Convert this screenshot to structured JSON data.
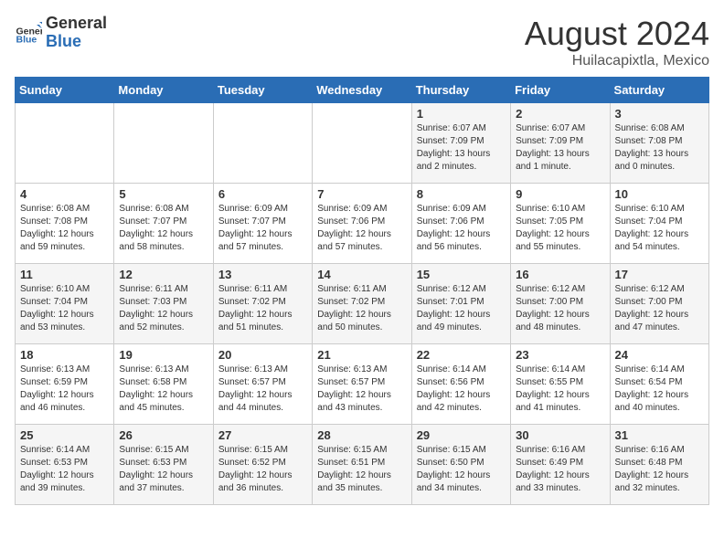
{
  "logo": {
    "general": "General",
    "blue": "Blue"
  },
  "title": {
    "month_year": "August 2024",
    "location": "Huilacapixtla, Mexico"
  },
  "days_of_week": [
    "Sunday",
    "Monday",
    "Tuesday",
    "Wednesday",
    "Thursday",
    "Friday",
    "Saturday"
  ],
  "weeks": [
    [
      {
        "day": "",
        "content": ""
      },
      {
        "day": "",
        "content": ""
      },
      {
        "day": "",
        "content": ""
      },
      {
        "day": "",
        "content": ""
      },
      {
        "day": "1",
        "content": "Sunrise: 6:07 AM\nSunset: 7:09 PM\nDaylight: 13 hours\nand 2 minutes."
      },
      {
        "day": "2",
        "content": "Sunrise: 6:07 AM\nSunset: 7:09 PM\nDaylight: 13 hours\nand 1 minute."
      },
      {
        "day": "3",
        "content": "Sunrise: 6:08 AM\nSunset: 7:08 PM\nDaylight: 13 hours\nand 0 minutes."
      }
    ],
    [
      {
        "day": "4",
        "content": "Sunrise: 6:08 AM\nSunset: 7:08 PM\nDaylight: 12 hours\nand 59 minutes."
      },
      {
        "day": "5",
        "content": "Sunrise: 6:08 AM\nSunset: 7:07 PM\nDaylight: 12 hours\nand 58 minutes."
      },
      {
        "day": "6",
        "content": "Sunrise: 6:09 AM\nSunset: 7:07 PM\nDaylight: 12 hours\nand 57 minutes."
      },
      {
        "day": "7",
        "content": "Sunrise: 6:09 AM\nSunset: 7:06 PM\nDaylight: 12 hours\nand 57 minutes."
      },
      {
        "day": "8",
        "content": "Sunrise: 6:09 AM\nSunset: 7:06 PM\nDaylight: 12 hours\nand 56 minutes."
      },
      {
        "day": "9",
        "content": "Sunrise: 6:10 AM\nSunset: 7:05 PM\nDaylight: 12 hours\nand 55 minutes."
      },
      {
        "day": "10",
        "content": "Sunrise: 6:10 AM\nSunset: 7:04 PM\nDaylight: 12 hours\nand 54 minutes."
      }
    ],
    [
      {
        "day": "11",
        "content": "Sunrise: 6:10 AM\nSunset: 7:04 PM\nDaylight: 12 hours\nand 53 minutes."
      },
      {
        "day": "12",
        "content": "Sunrise: 6:11 AM\nSunset: 7:03 PM\nDaylight: 12 hours\nand 52 minutes."
      },
      {
        "day": "13",
        "content": "Sunrise: 6:11 AM\nSunset: 7:02 PM\nDaylight: 12 hours\nand 51 minutes."
      },
      {
        "day": "14",
        "content": "Sunrise: 6:11 AM\nSunset: 7:02 PM\nDaylight: 12 hours\nand 50 minutes."
      },
      {
        "day": "15",
        "content": "Sunrise: 6:12 AM\nSunset: 7:01 PM\nDaylight: 12 hours\nand 49 minutes."
      },
      {
        "day": "16",
        "content": "Sunrise: 6:12 AM\nSunset: 7:00 PM\nDaylight: 12 hours\nand 48 minutes."
      },
      {
        "day": "17",
        "content": "Sunrise: 6:12 AM\nSunset: 7:00 PM\nDaylight: 12 hours\nand 47 minutes."
      }
    ],
    [
      {
        "day": "18",
        "content": "Sunrise: 6:13 AM\nSunset: 6:59 PM\nDaylight: 12 hours\nand 46 minutes."
      },
      {
        "day": "19",
        "content": "Sunrise: 6:13 AM\nSunset: 6:58 PM\nDaylight: 12 hours\nand 45 minutes."
      },
      {
        "day": "20",
        "content": "Sunrise: 6:13 AM\nSunset: 6:57 PM\nDaylight: 12 hours\nand 44 minutes."
      },
      {
        "day": "21",
        "content": "Sunrise: 6:13 AM\nSunset: 6:57 PM\nDaylight: 12 hours\nand 43 minutes."
      },
      {
        "day": "22",
        "content": "Sunrise: 6:14 AM\nSunset: 6:56 PM\nDaylight: 12 hours\nand 42 minutes."
      },
      {
        "day": "23",
        "content": "Sunrise: 6:14 AM\nSunset: 6:55 PM\nDaylight: 12 hours\nand 41 minutes."
      },
      {
        "day": "24",
        "content": "Sunrise: 6:14 AM\nSunset: 6:54 PM\nDaylight: 12 hours\nand 40 minutes."
      }
    ],
    [
      {
        "day": "25",
        "content": "Sunrise: 6:14 AM\nSunset: 6:53 PM\nDaylight: 12 hours\nand 39 minutes."
      },
      {
        "day": "26",
        "content": "Sunrise: 6:15 AM\nSunset: 6:53 PM\nDaylight: 12 hours\nand 37 minutes."
      },
      {
        "day": "27",
        "content": "Sunrise: 6:15 AM\nSunset: 6:52 PM\nDaylight: 12 hours\nand 36 minutes."
      },
      {
        "day": "28",
        "content": "Sunrise: 6:15 AM\nSunset: 6:51 PM\nDaylight: 12 hours\nand 35 minutes."
      },
      {
        "day": "29",
        "content": "Sunrise: 6:15 AM\nSunset: 6:50 PM\nDaylight: 12 hours\nand 34 minutes."
      },
      {
        "day": "30",
        "content": "Sunrise: 6:16 AM\nSunset: 6:49 PM\nDaylight: 12 hours\nand 33 minutes."
      },
      {
        "day": "31",
        "content": "Sunrise: 6:16 AM\nSunset: 6:48 PM\nDaylight: 12 hours\nand 32 minutes."
      }
    ]
  ]
}
